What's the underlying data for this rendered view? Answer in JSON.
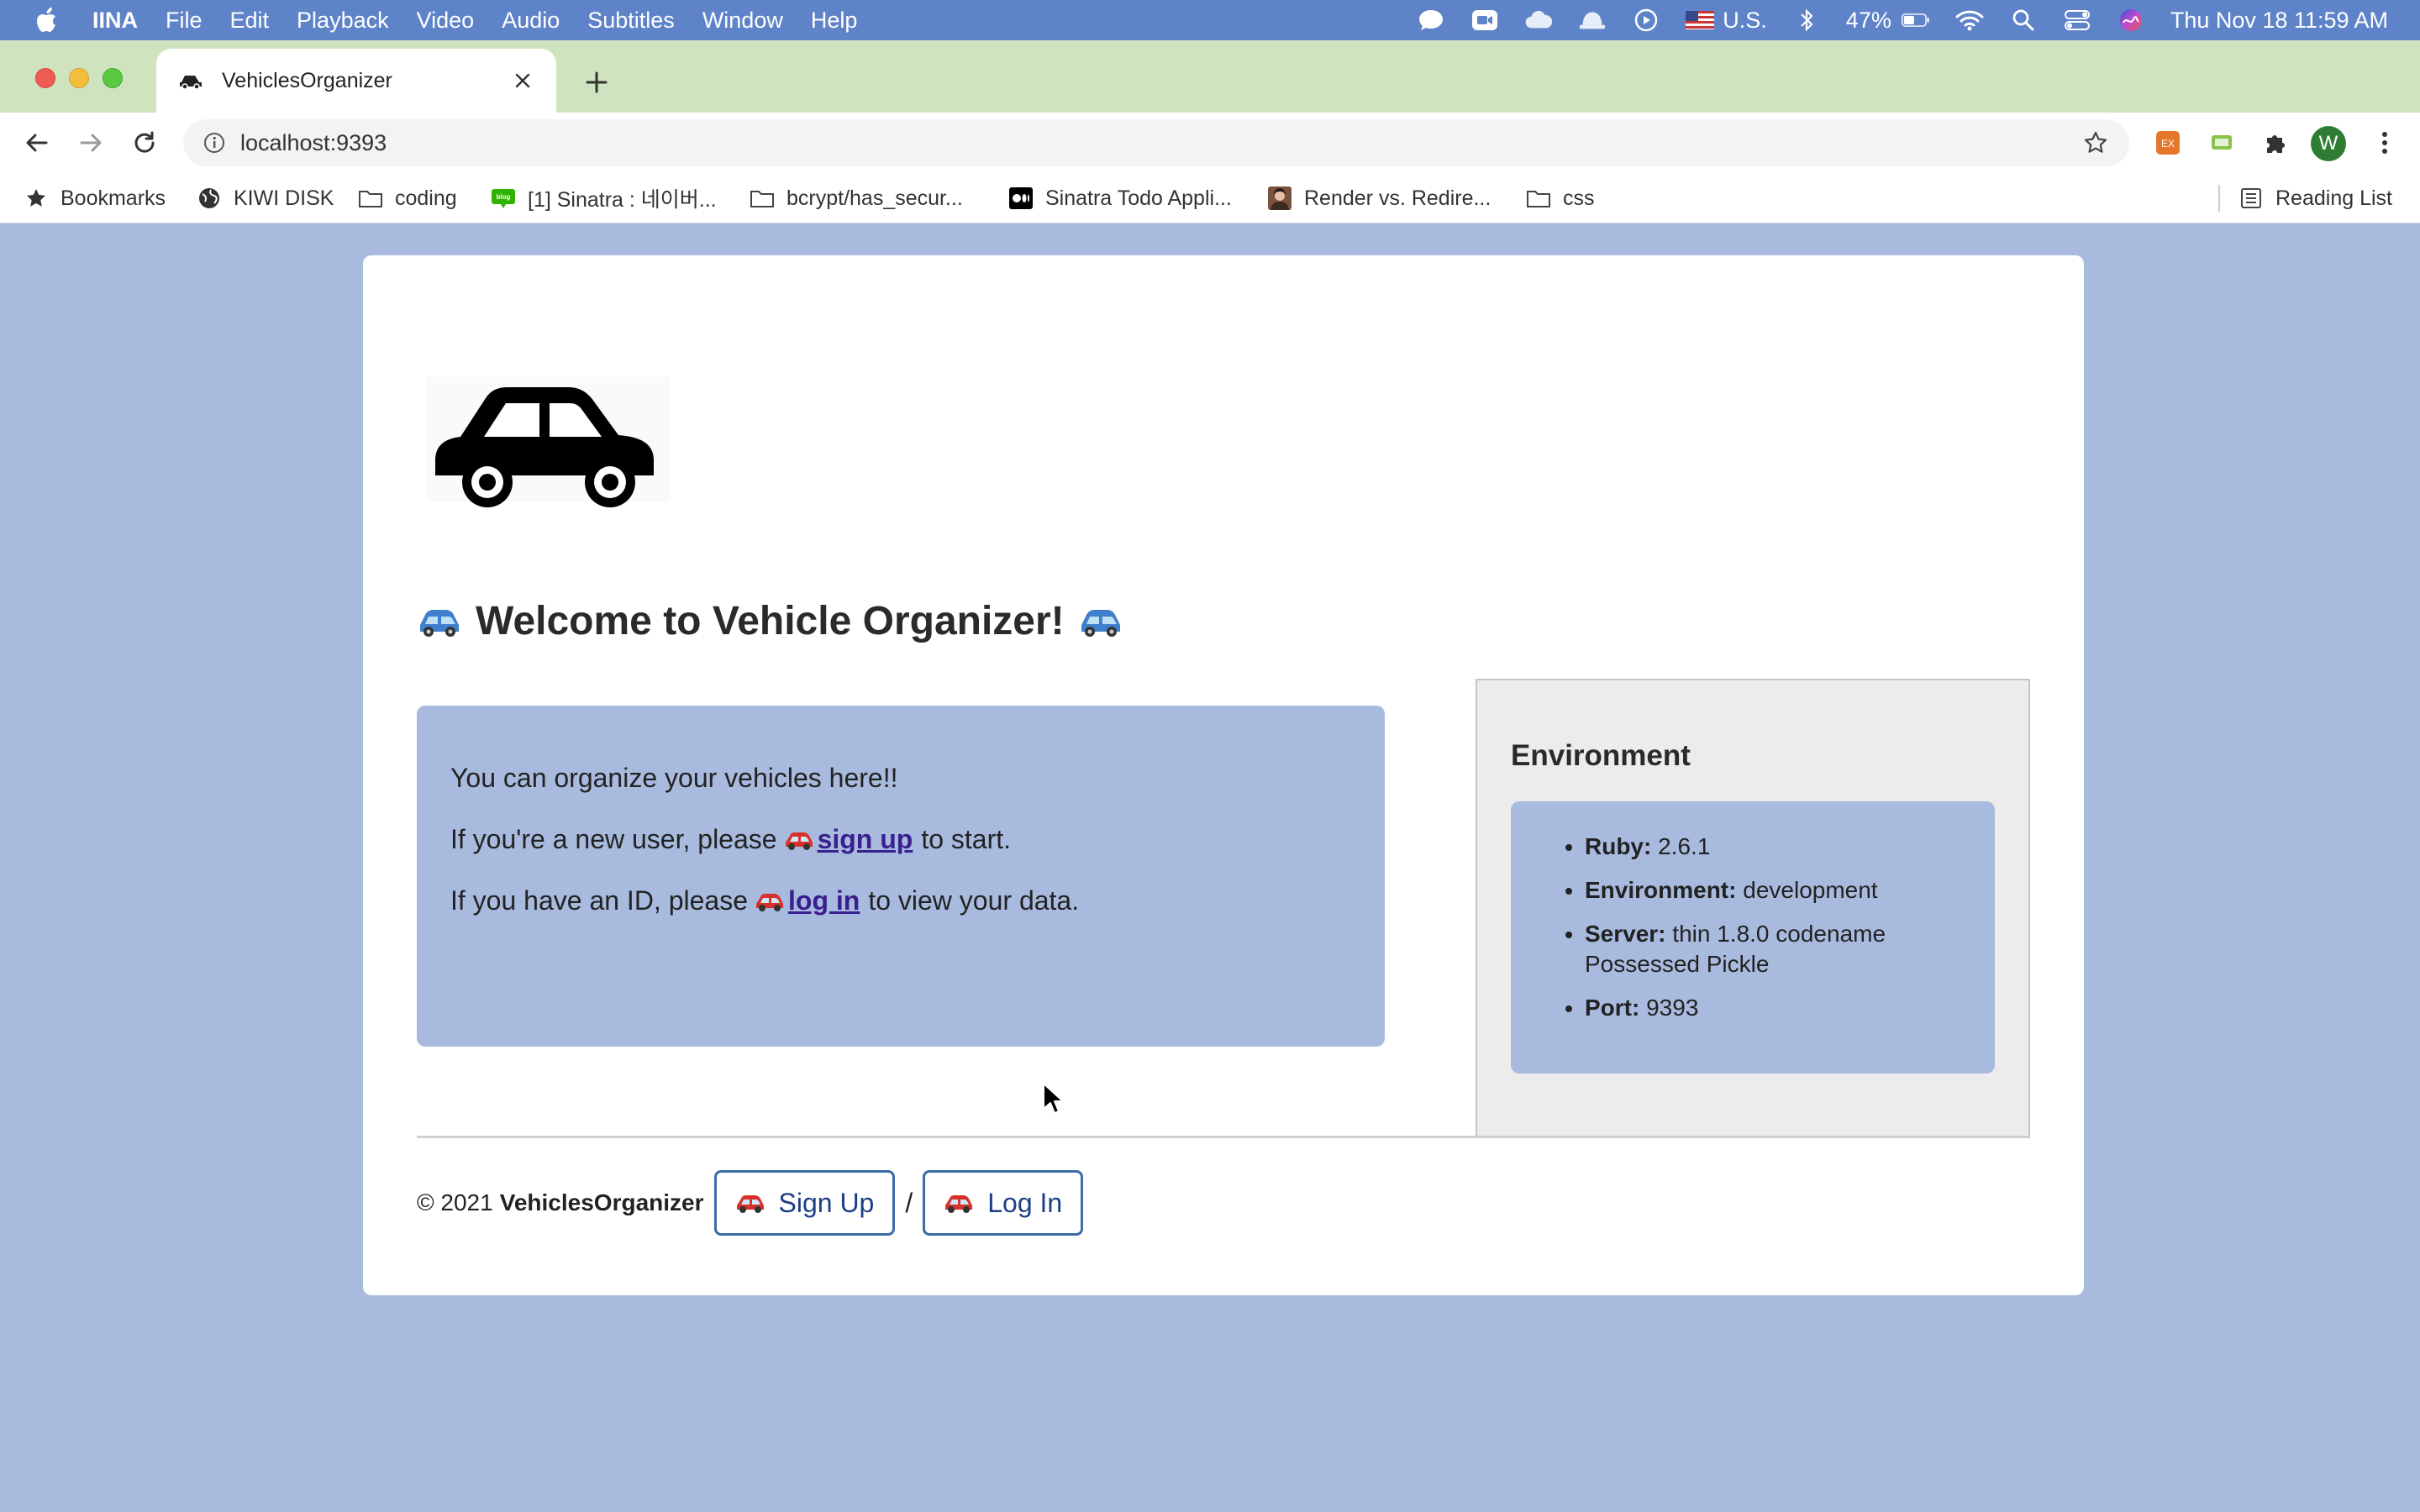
{
  "menubar": {
    "app_name": "IINA",
    "items": [
      "File",
      "Edit",
      "Playback",
      "Video",
      "Audio",
      "Subtitles",
      "Window",
      "Help"
    ],
    "input_source": "U.S.",
    "battery": "47%",
    "datetime": "Thu Nov 18  11:59 AM"
  },
  "browser": {
    "tab_title": "VehiclesOrganizer",
    "url": "localhost:9393",
    "avatar_letter": "W",
    "bookmarks": [
      {
        "label": "Bookmarks",
        "icon": "star-icon"
      },
      {
        "label": "KIWI DISK",
        "icon": "globe-icon"
      },
      {
        "label": "coding",
        "icon": "folder-icon"
      },
      {
        "label": "[1] Sinatra : 네이버...",
        "icon": "blog-icon"
      },
      {
        "label": "bcrypt/has_secur...",
        "icon": "folder-icon"
      },
      {
        "label": "Sinatra Todo Appli...",
        "icon": "medium-icon"
      },
      {
        "label": "Render vs. Redire...",
        "icon": "profile-icon"
      },
      {
        "label": "css",
        "icon": "folder-icon"
      }
    ],
    "reading_list": "Reading List"
  },
  "page": {
    "welcome": "Welcome to Vehicle Organizer!",
    "intro_line1": "You can organize your vehicles here!!",
    "intro_line2_pre": "If you're a new user, please",
    "intro_line2_link": "sign up",
    "intro_line2_post": "to start.",
    "intro_line3_pre": "If you have an ID, please",
    "intro_line3_link": "log in",
    "intro_line3_post": "to view your data.",
    "environment": {
      "title": "Environment",
      "items": [
        {
          "key": "Ruby:",
          "value": "2.6.1"
        },
        {
          "key": "Environment:",
          "value": "development"
        },
        {
          "key": "Server:",
          "value": "thin 1.8.0 codename Possessed Pickle"
        },
        {
          "key": "Port:",
          "value": "9393"
        }
      ]
    },
    "footer": {
      "copyright": "© 2021",
      "brand": "VehiclesOrganizer",
      "signup_button": "Sign Up",
      "separator": "/",
      "login_button": "Log In"
    }
  },
  "colors": {
    "page_background": "#a8bbdf",
    "menubar": "#5f83c8",
    "tabstrip": "#cfe3bf",
    "link": "#3a1f8f",
    "button_border": "#3b6ba5"
  }
}
